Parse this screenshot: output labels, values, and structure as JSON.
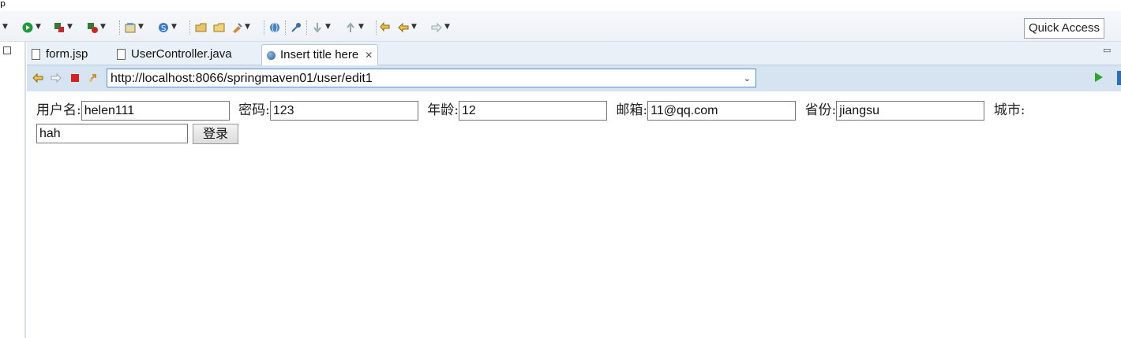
{
  "menu_stub": {
    "text": "p"
  },
  "toolbar": {
    "quick_access": "Quick Access"
  },
  "tabs": [
    {
      "label": "form.jsp",
      "active": false
    },
    {
      "label": "UserController.java",
      "active": false
    },
    {
      "label": "Insert title here",
      "active": true
    }
  ],
  "browser": {
    "url": "http://localhost:8066/springmaven01/user/edit1"
  },
  "form": {
    "username_label": "用户名:",
    "username_value": "helen111",
    "password_label": "密码:",
    "password_value": "123",
    "age_label": "年龄:",
    "age_value": "12",
    "email_label": "邮箱:",
    "email_value": "11@qq.com",
    "province_label": "省份:",
    "province_value": "jiangsu",
    "city_label": "城市:",
    "city_value": "hah",
    "submit_label": "登录"
  },
  "colors": {
    "accent": "#2c6fb7",
    "go_green": "#2aa52a",
    "stop_red": "#d32222",
    "nav_bg": "#d6e3f1"
  }
}
